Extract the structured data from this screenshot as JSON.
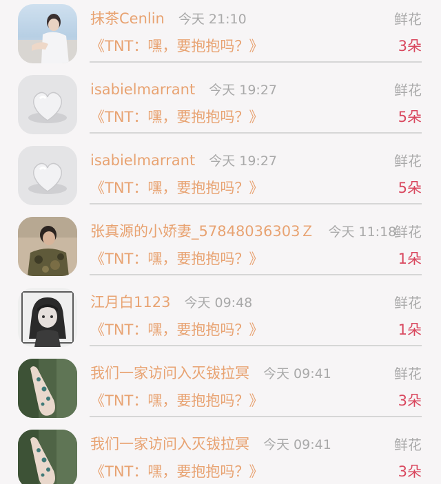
{
  "gifts": [
    {
      "sender": "抹茶Cenlin",
      "time": "今天 21:10",
      "flower_label": "鲜花",
      "message": "《TNT：嘿，要抱抱吗？》",
      "count": "3朵",
      "avatar": "boy-on-beach-avatar"
    },
    {
      "sender": "isabielmarrant",
      "time": "今天 19:27",
      "flower_label": "鲜花",
      "message": "《TNT：嘿，要抱抱吗？》",
      "count": "5朵",
      "avatar": "glass-heart-avatar"
    },
    {
      "sender": "isabielmarrant",
      "time": "今天 19:27",
      "flower_label": "鲜花",
      "message": "《TNT：嘿，要抱抱吗？》",
      "count": "5朵",
      "avatar": "glass-heart-avatar"
    },
    {
      "sender": "张真源的小娇妻_57848036303Ｚ",
      "time": "今天 11:18",
      "flower_label": "鲜花",
      "message": "《TNT：嘿，要抱抱吗？》",
      "count": "1朵",
      "avatar": "camo-jacket-avatar"
    },
    {
      "sender": "江月白1123",
      "time": "今天 09:48",
      "flower_label": "鲜花",
      "message": "《TNT：嘿，要抱抱吗？》",
      "count": "1朵",
      "avatar": "anime-girl-avatar"
    },
    {
      "sender": "我们一家访问入灭钹拉冥",
      "time": "今天 09:41",
      "flower_label": "鲜花",
      "message": "《TNT：嘿，要抱抱吗？》",
      "count": "3朵",
      "avatar": "painted-hand-avatar"
    },
    {
      "sender": "我们一家访问入灭钹拉冥",
      "time": "今天 09:41",
      "flower_label": "鲜花",
      "message": "《TNT：嘿，要抱抱吗？》",
      "count": "3朵",
      "avatar": "painted-hand-avatar"
    }
  ],
  "colors": {
    "sender": "#e8a372",
    "count": "#d9475e",
    "muted": "#a9a9a9",
    "background": "#f7f5f6"
  }
}
